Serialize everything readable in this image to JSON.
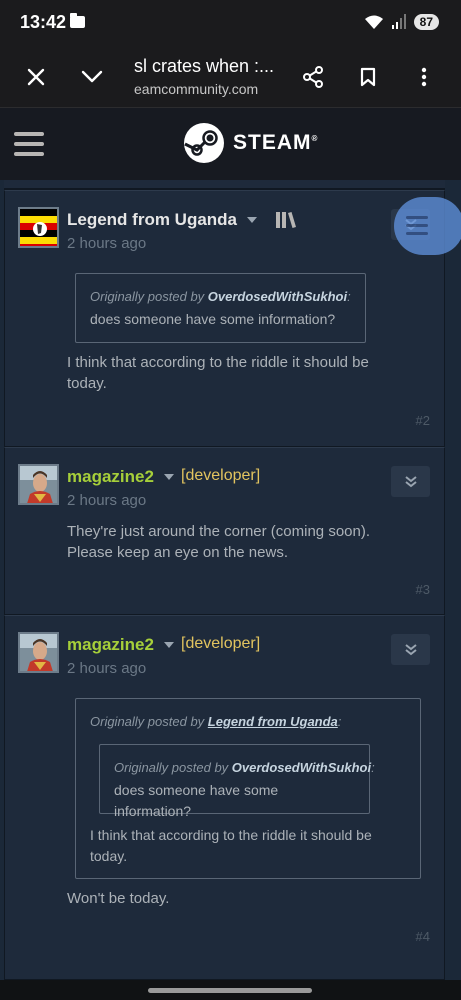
{
  "status_bar": {
    "time": "13:42",
    "battery": "87"
  },
  "browser": {
    "title": "sl crates when :...",
    "domain": "eamcommunity.com"
  },
  "steam": {
    "wordmark": "STEAM",
    "registered": "®"
  },
  "posts": [
    {
      "author": "Legend from Uganda",
      "time": "2 hours ago",
      "quote": {
        "prefix": "Originally posted by ",
        "author": "OverdosedWithSukhoi",
        "suffix": ":",
        "text": "does someone have some information?"
      },
      "body_line1": "I think that according to the riddle it should be",
      "body_line2": "today.",
      "number": "#2"
    },
    {
      "author": "magazine2",
      "dev_tag": "[developer]",
      "time": "2 hours ago",
      "body_line1": "They're just around the corner (coming soon).",
      "body_line2": "Please keep an eye on the news.",
      "number": "#3"
    },
    {
      "author": "magazine2",
      "dev_tag": "[developer]",
      "time": "2 hours ago",
      "outer_quote": {
        "prefix": "Originally posted by ",
        "author": "Legend from Uganda",
        "suffix": ":",
        "inner_prefix": "Originally posted by ",
        "inner_author": "OverdosedWithSukhoi",
        "inner_suffix": ":",
        "inner_text": "does someone have some information?",
        "text_line1": "I think that according to the riddle it should be",
        "text_line2": "today."
      },
      "body_line1": "Won't be today.",
      "number": "#4"
    }
  ],
  "colors": {
    "developer_name": "#a6cf3a",
    "developer_tag": "#e2c45f",
    "background": "#1b2838"
  }
}
